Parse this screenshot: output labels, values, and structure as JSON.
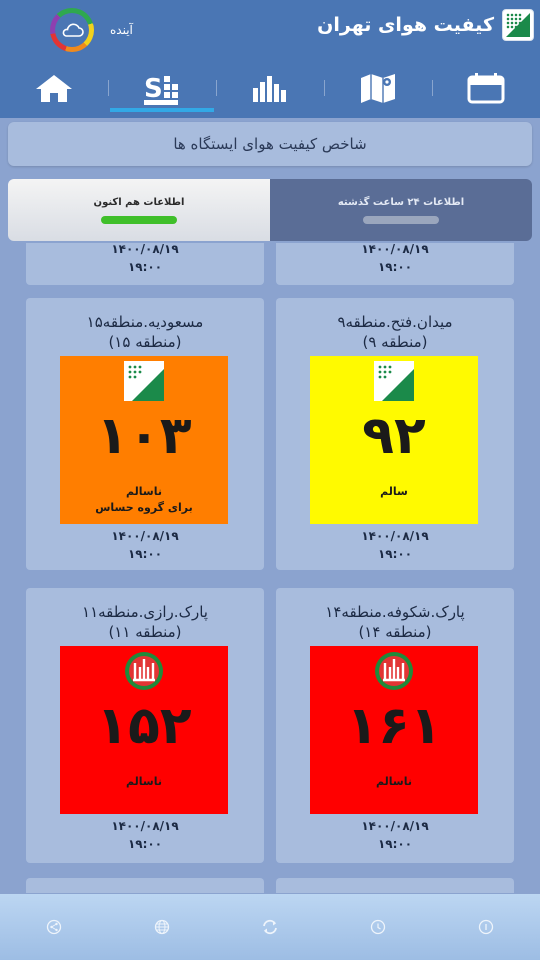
{
  "header": {
    "app_title": "کیفیت هوای تهران",
    "forecast_label": "آینده"
  },
  "nav": {
    "items": [
      "home-icon",
      "stations-icon",
      "bar-chart-icon",
      "map-icon",
      "calendar-icon"
    ],
    "active": 1
  },
  "page_title": "شاخص کیفیت هوای ایستگاه ها",
  "tabs": {
    "past_24h": "اطلاعات ۲۴ ساعت گذشته",
    "now": "اطلاعات هم اکنون",
    "active": "now"
  },
  "colors": {
    "healthy": "#fffa00",
    "unhealthy_sensitive": "#ff7e00",
    "unhealthy": "#ff0000",
    "header": "#4a76b4",
    "background": "#8ba3cf"
  },
  "prev_cards": [
    {
      "date": "۱۴۰۰/۰۸/۱۹",
      "time": "۱۹:۰۰"
    },
    {
      "date": "۱۴۰۰/۰۸/۱۹",
      "time": "۱۹:۰۰"
    }
  ],
  "stations": [
    {
      "name": "میدان.فتح.منطقه۹",
      "district": "(منطقه ۹)",
      "aqi": "۹۲",
      "status_1": "سالم",
      "status_2": "",
      "level": "healthy",
      "icon": "green-leaf-logo-icon",
      "date": "۱۴۰۰/۰۸/۱۹",
      "time": "۱۹:۰۰"
    },
    {
      "name": "مسعودیه.منطقه۱۵",
      "district": "(منطقه ۱۵)",
      "aqi": "۱۰۳",
      "status_1": "ناسالم",
      "status_2": "برای گروه حساس",
      "level": "unhealthy_sensitive",
      "icon": "green-leaf-logo-icon",
      "date": "۱۴۰۰/۰۸/۱۹",
      "time": "۱۹:۰۰"
    },
    {
      "name": "پارک.شکوفه.منطقه۱۴",
      "district": "(منطقه ۱۴)",
      "aqi": "۱۶۱",
      "status_1": "ناسالم",
      "status_2": "",
      "level": "unhealthy",
      "icon": "tehran-municipality-emblem-icon",
      "date": "۱۴۰۰/۰۸/۱۹",
      "time": "۱۹:۰۰"
    },
    {
      "name": "پارک.رازی.منطقه۱۱",
      "district": "(منطقه ۱۱)",
      "aqi": "۱۵۲",
      "status_1": "ناسالم",
      "status_2": "",
      "level": "unhealthy",
      "icon": "tehran-municipality-emblem-icon",
      "date": "۱۴۰۰/۰۸/۱۹",
      "time": "۱۹:۰۰"
    }
  ],
  "bottom_bar": [
    "share-icon",
    "globe-icon",
    "refresh-icon",
    "info-icon",
    "clock-icon"
  ]
}
